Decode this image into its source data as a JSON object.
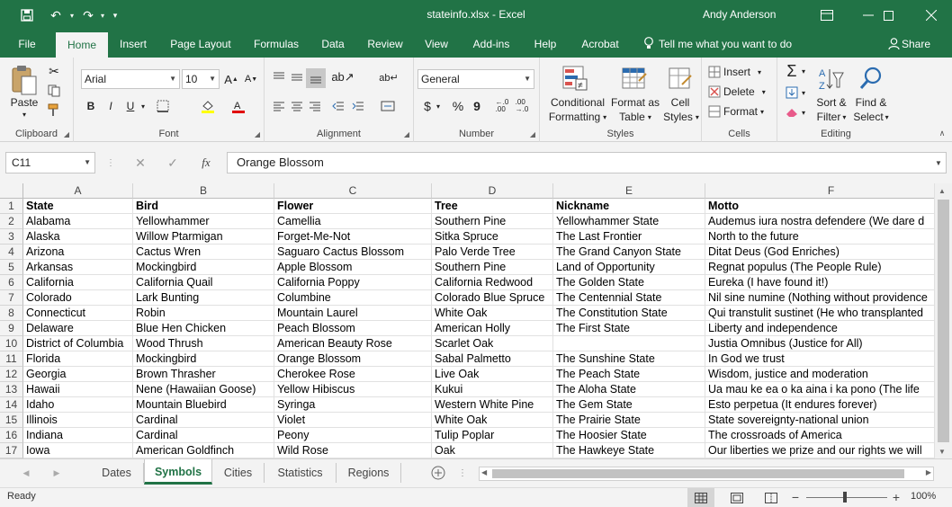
{
  "titlebar": {
    "doc_title": "stateinfo.xlsx  -  Excel",
    "user": "Andy Anderson",
    "accent": "#217346"
  },
  "ribbon_tabs": [
    "File",
    "Home",
    "Insert",
    "Page Layout",
    "Formulas",
    "Data",
    "Review",
    "View",
    "Add-ins",
    "Help",
    "Acrobat"
  ],
  "tell_me": "Tell me what you want to do",
  "share": "Share",
  "ribbon": {
    "clipboard": {
      "label": "Clipboard",
      "paste": "Paste"
    },
    "font": {
      "label": "Font",
      "name": "Arial",
      "size": "10",
      "bold": "B",
      "italic": "I",
      "underline": "U"
    },
    "alignment": {
      "label": "Alignment"
    },
    "number": {
      "label": "Number",
      "format": "General",
      "currency": "$",
      "percent": "%",
      "comma": "9"
    },
    "styles": {
      "label": "Styles",
      "cond_format_1": "Conditional",
      "cond_format_2": "Formatting",
      "format_table_1": "Format as",
      "format_table_2": "Table",
      "cell_styles_1": "Cell",
      "cell_styles_2": "Styles"
    },
    "cells": {
      "label": "Cells",
      "insert": "Insert",
      "delete": "Delete",
      "format": "Format"
    },
    "editing": {
      "label": "Editing",
      "sort_1": "Sort &",
      "sort_2": "Filter",
      "find_1": "Find &",
      "find_2": "Select"
    }
  },
  "formula_bar": {
    "name_box": "C11",
    "formula": "Orange Blossom",
    "fx": "fx"
  },
  "grid": {
    "columns": [
      "A",
      "B",
      "C",
      "D",
      "E",
      "F"
    ],
    "rows": [
      "1",
      "2",
      "3",
      "4",
      "5",
      "6",
      "7",
      "8",
      "9",
      "10",
      "11",
      "12",
      "13",
      "14",
      "15",
      "16",
      "17"
    ],
    "cells": [
      [
        "State",
        "Bird",
        "Flower",
        "Tree",
        "Nickname",
        "Motto"
      ],
      [
        "Alabama",
        "Yellowhammer",
        "Camellia",
        "Southern Pine",
        "Yellowhammer State",
        "Audemus iura nostra defendere (We dare d"
      ],
      [
        "Alaska",
        "Willow Ptarmigan",
        "Forget-Me-Not",
        "Sitka Spruce",
        "The Last Frontier",
        "North to the future"
      ],
      [
        "Arizona",
        "Cactus Wren",
        "Saguaro Cactus Blossom",
        "Palo Verde Tree",
        "The Grand Canyon State",
        "Ditat Deus (God Enriches)"
      ],
      [
        "Arkansas",
        "Mockingbird",
        "Apple Blossom",
        "Southern Pine",
        "Land of Opportunity",
        "Regnat populus (The People Rule)"
      ],
      [
        "California",
        "California Quail",
        "California Poppy",
        "California Redwood",
        "The Golden State",
        "Eureka (I have found it!)"
      ],
      [
        "Colorado",
        "Lark Bunting",
        "Columbine",
        "Colorado Blue Spruce",
        "The Centennial State",
        "Nil sine numine (Nothing without providence"
      ],
      [
        "Connecticut",
        "Robin",
        "Mountain Laurel",
        "White Oak",
        "The Constitution State",
        "Qui transtulit sustinet (He who transplanted"
      ],
      [
        "Delaware",
        "Blue Hen Chicken",
        "Peach Blossom",
        "American Holly",
        "The First State",
        "Liberty and independence"
      ],
      [
        "District of Columbia",
        "Wood Thrush",
        "American Beauty Rose",
        "Scarlet Oak",
        "",
        "Justia Omnibus (Justice for All)"
      ],
      [
        "Florida",
        "Mockingbird",
        "Orange Blossom",
        "Sabal Palmetto",
        "The Sunshine State",
        "In God we trust"
      ],
      [
        "Georgia",
        "Brown Thrasher",
        "Cherokee Rose",
        "Live Oak",
        "The Peach State",
        "Wisdom, justice and moderation"
      ],
      [
        "Hawaii",
        "Nene (Hawaiian Goose)",
        "Yellow Hibiscus",
        "Kukui",
        "The Aloha State",
        "Ua mau ke ea o ka aina i ka pono (The life"
      ],
      [
        "Idaho",
        "Mountain Bluebird",
        "Syringa",
        "Western White Pine",
        "The Gem State",
        "Esto perpetua (It endures forever)"
      ],
      [
        "Illinois",
        "Cardinal",
        "Violet",
        "White Oak",
        "The Prairie State",
        "State sovereignty-national union"
      ],
      [
        "Indiana",
        "Cardinal",
        "Peony",
        "Tulip Poplar",
        "The Hoosier State",
        "The crossroads of America"
      ],
      [
        "Iowa",
        "American Goldfinch",
        "Wild Rose",
        "Oak",
        "The Hawkeye State",
        "Our liberties we prize and our rights we will"
      ]
    ]
  },
  "sheets": [
    "Dates",
    "Symbols",
    "Cities",
    "Statistics",
    "Regions"
  ],
  "status": {
    "ready": "Ready",
    "zoom": "100%"
  }
}
